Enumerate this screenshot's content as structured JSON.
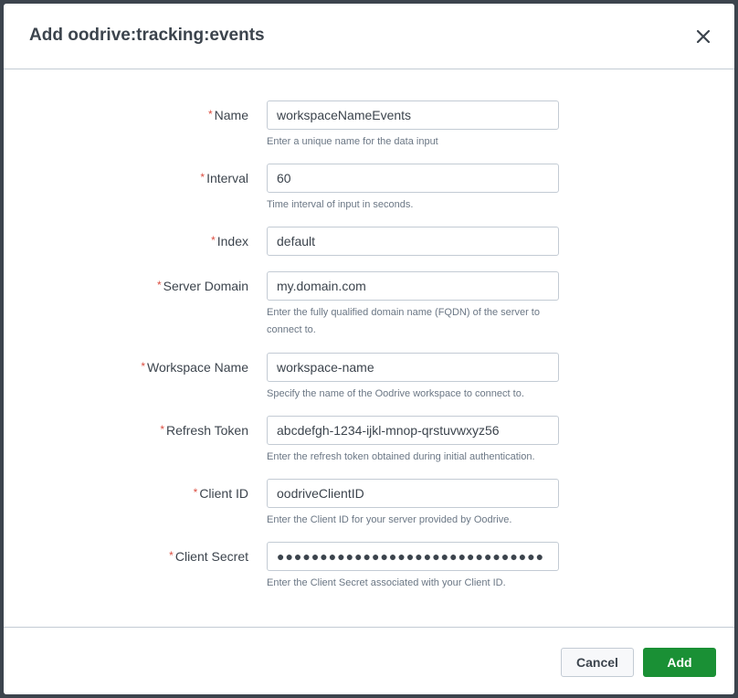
{
  "modal": {
    "title": "Add oodrive:tracking:events",
    "close_icon": "close-icon"
  },
  "fields": [
    {
      "label": "Name",
      "value": "workspaceNameEvents",
      "help": "Enter a unique name for the data input",
      "required": "*"
    },
    {
      "label": "Interval",
      "value": "60",
      "help": "Time interval of input in seconds.",
      "required": "*"
    },
    {
      "label": "Index",
      "value": "default",
      "help": "",
      "required": "*"
    },
    {
      "label": "Server Domain",
      "value": "my.domain.com",
      "help": "Enter the fully qualified domain name (FQDN) of the server to connect to.",
      "required": "*"
    },
    {
      "label": "Workspace Name",
      "value": "workspace-name",
      "help": "Specify the name of the Oodrive workspace to connect to.",
      "required": "*"
    },
    {
      "label": "Refresh Token",
      "value": "abcdefgh-1234-ijkl-mnop-qrstuvwxyz56",
      "help": "Enter the refresh token obtained during initial authentication.",
      "required": "*"
    },
    {
      "label": "Client ID",
      "value": "oodriveClientID",
      "help": "Enter the Client ID for your server provided by Oodrive.",
      "required": "*"
    },
    {
      "label": "Client Secret",
      "value": "●●●●●●●●●●●●●●●●●●●●●●●●●●●●●●●",
      "help": "Enter the Client Secret associated with your Client ID.",
      "required": "*"
    }
  ],
  "footer": {
    "cancel_label": "Cancel",
    "add_label": "Add"
  },
  "colors": {
    "required": "#dc4e41",
    "primary": "#1a9035",
    "title": "#3c444d",
    "help": "#6b7785"
  }
}
